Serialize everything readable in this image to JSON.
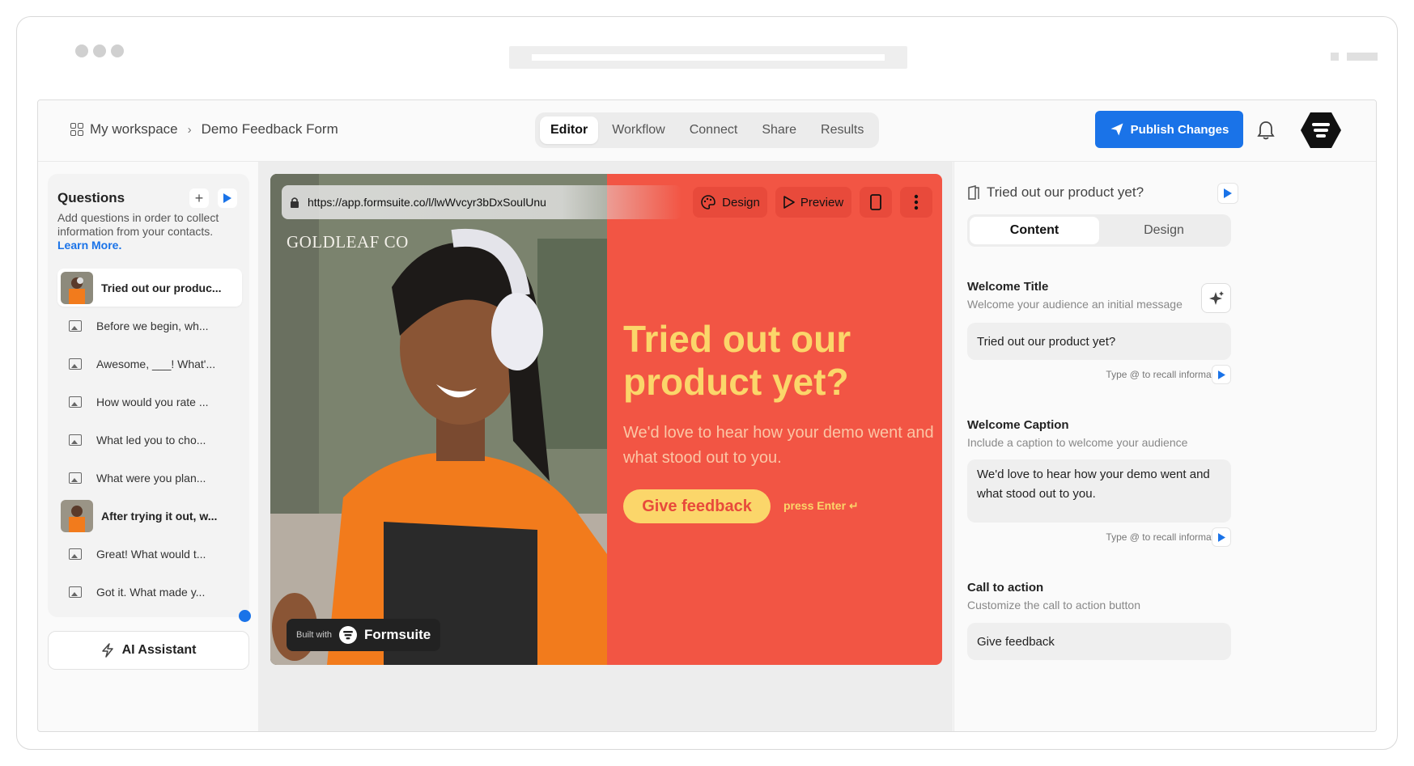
{
  "breadcrumb": {
    "workspace": "My workspace",
    "form": "Demo Feedback Form"
  },
  "tabs": [
    {
      "label": "Editor",
      "active": true
    },
    {
      "label": "Workflow"
    },
    {
      "label": "Connect"
    },
    {
      "label": "Share"
    },
    {
      "label": "Results"
    }
  ],
  "header": {
    "publish_label": "Publish Changes",
    "accent": "#1a73e8"
  },
  "sidebar": {
    "title": "Questions",
    "description": "Add questions in order to collect information from your contacts.",
    "learn_more": "Learn More.",
    "items": [
      {
        "label": "Tried out our produc...",
        "icon": "thumbnail",
        "active": true
      },
      {
        "label": "Before we begin, wh...",
        "icon": "image-icon"
      },
      {
        "label": "Awesome, ___! What'...",
        "icon": "image-icon"
      },
      {
        "label": "How would you rate ...",
        "icon": "image-icon"
      },
      {
        "label": "What led you to cho...",
        "icon": "image-icon"
      },
      {
        "label": "What were you plan...",
        "icon": "image-icon"
      },
      {
        "label": "After trying it out, w...",
        "icon": "thumbnail"
      },
      {
        "label": "Great! What would t...",
        "icon": "image-icon"
      },
      {
        "label": "Got it. What made y...",
        "icon": "image-icon"
      }
    ],
    "ai_assistant": "AI Assistant"
  },
  "preview": {
    "url": "https://app.formsuite.co/l/lwWvcyr3bDxSoulUnu",
    "design_label": "Design",
    "preview_label": "Preview",
    "brand": "GOLDLEAF CO",
    "headline": "Tried out our product yet?",
    "caption": "We'd love to hear how your demo went and what stood out to you.",
    "cta": "Give feedback",
    "enter_hint": "press Enter ↵",
    "built_with": "Built with",
    "built_brand": "Formsuite",
    "colors": {
      "panel": "#f25544",
      "headline": "#fbd66a"
    }
  },
  "panel": {
    "title": "Tried out our product yet?",
    "tab_content": "Content",
    "tab_design": "Design",
    "welcome_title_label": "Welcome Title",
    "welcome_title_sub": "Welcome your audience an initial message",
    "welcome_title_value": "Tried out our product yet?",
    "recall_hint": "Type @ to recall information",
    "caption_label": "Welcome Caption",
    "caption_sub": "Include a caption to welcome your audience",
    "caption_value": "We'd love to hear how your demo went and what stood out to you.",
    "cta_label": "Call to action",
    "cta_sub": "Customize the call to action button",
    "cta_value": "Give feedback"
  }
}
